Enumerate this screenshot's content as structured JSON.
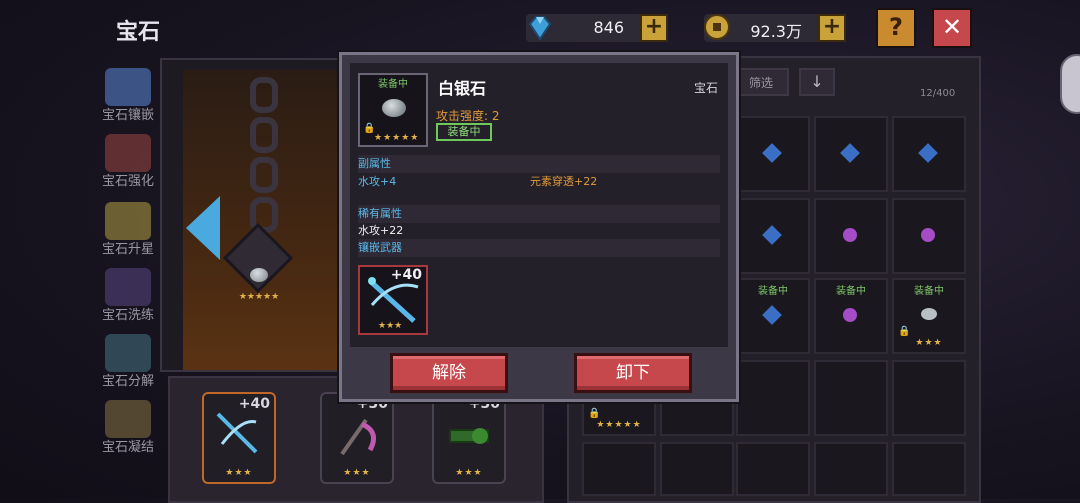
{
  "header": {
    "title": "宝石",
    "diamonds": "846",
    "gold": "92.3万",
    "help_label": "?",
    "close_label": "✕"
  },
  "sidebar": {
    "items": [
      {
        "label": "宝石镶嵌"
      },
      {
        "label": "宝石强化"
      },
      {
        "label": "宝石升星"
      },
      {
        "label": "宝石洗练"
      },
      {
        "label": "宝石分解"
      },
      {
        "label": "宝石凝结"
      }
    ]
  },
  "forge": {
    "slot_stars": "★★★★★"
  },
  "weapon_slots": [
    {
      "level": "+40",
      "stars": "★★★"
    },
    {
      "level": "+30",
      "stars": "★★★"
    },
    {
      "level": "+30",
      "stars": "★★★"
    }
  ],
  "inventory": {
    "filter_label": "筛选",
    "sort_label": "↓",
    "count": "12/400",
    "equipped_badge": "装备中",
    "stars_5": "★★★★★",
    "stars_3": "★★★"
  },
  "popup": {
    "equipped_badge": "装备中",
    "gem_name": "白银石",
    "gem_type": "宝石",
    "attack_strength": "攻击强度: 2",
    "equipped_tag": "装备中",
    "stars": "★★★★★",
    "secondary_title": "副属性",
    "secondary_attr_1": "水攻+4",
    "secondary_attr_2": "元素穿透+22",
    "rare_title": "稀有属性",
    "rare_attr_1": "水攻+22",
    "rare_attr_2": "镶嵌武器",
    "weapon_level": "+40",
    "weapon_stars": "★★★",
    "remove_label": "解除",
    "unequip_label": "卸下"
  },
  "colors": {
    "accent_blue": "#4aa9df",
    "button_red": "#c7484c",
    "gold": "#c9a23a",
    "equipped_green": "#7ec86a"
  }
}
